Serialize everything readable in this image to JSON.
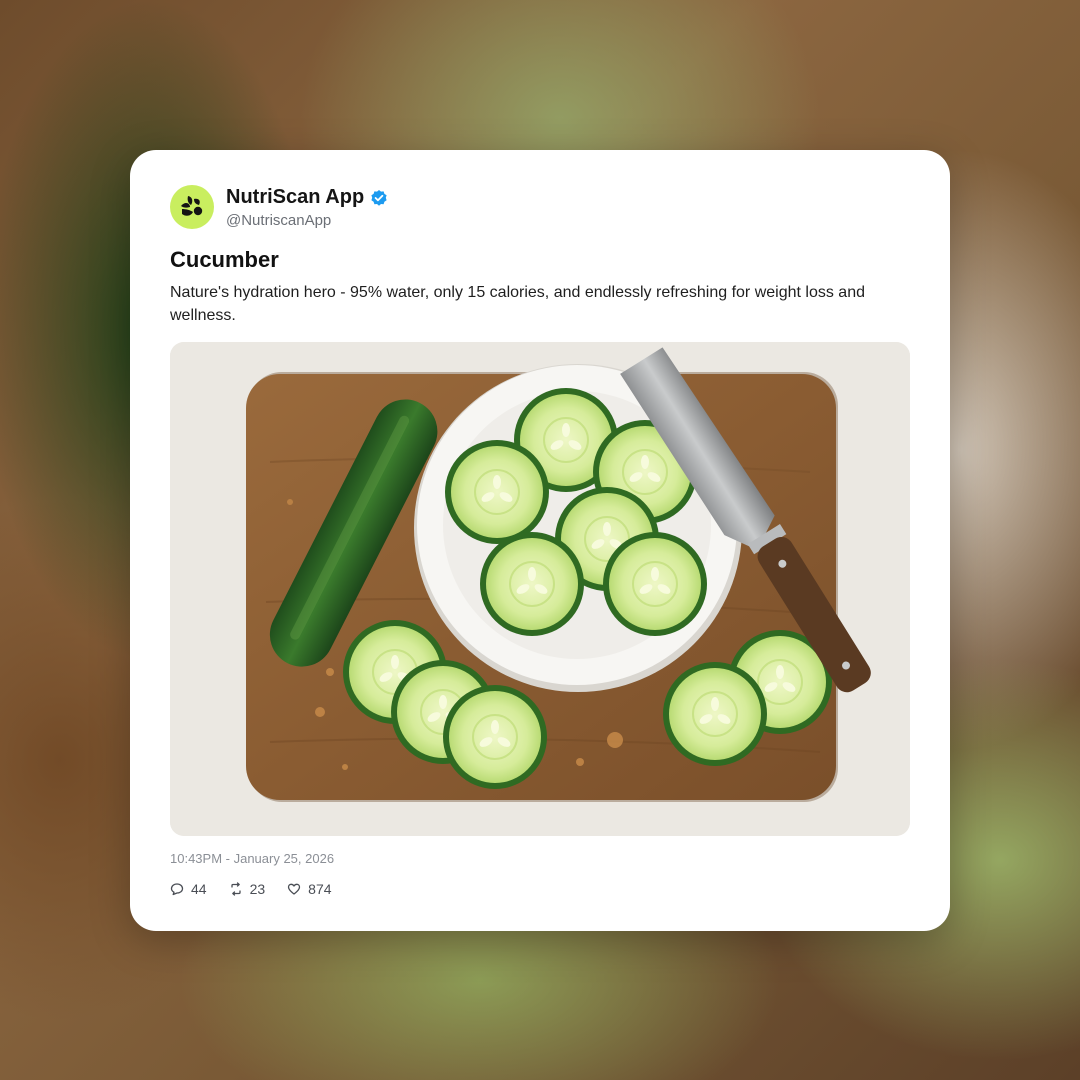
{
  "post": {
    "author_name": "NutriScan App",
    "handle": "@NutriscanApp",
    "verified": true,
    "title": "Cucumber",
    "description": "Nature's hydration hero - 95% water, only 15 calories, and endlessly refreshing for weight loss and wellness.",
    "timestamp": "10:43PM - January 25, 2026",
    "stats": {
      "replies": "44",
      "reposts": "23",
      "likes": "874"
    }
  },
  "icons": {
    "avatar": "nutriscan-logo-icon",
    "verified": "verified-badge-icon",
    "replies": "comment-icon",
    "reposts": "repost-icon",
    "likes": "heart-icon"
  },
  "colors": {
    "avatar_bg": "#c9ee5f",
    "verified_badge": "#1d9bf0",
    "card_bg": "#ffffff"
  }
}
